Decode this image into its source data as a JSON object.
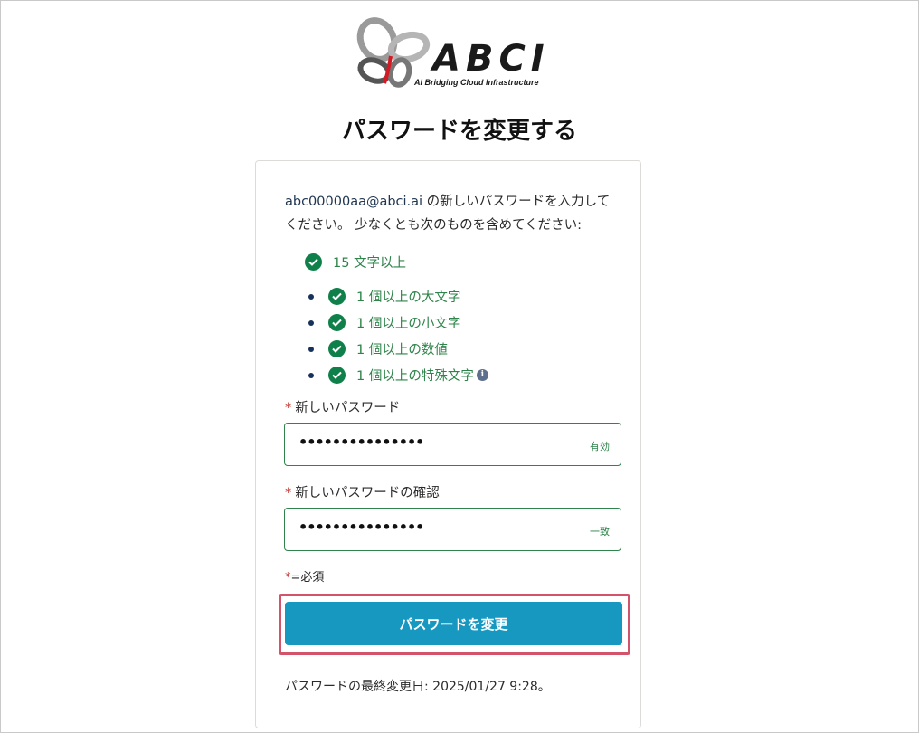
{
  "logo": {
    "text": "ABCI",
    "subtitle": "AI Bridging Cloud Infrastructure"
  },
  "page_title": "パスワードを変更する",
  "intro": {
    "email": "abc00000aa@abci.ai",
    "text_after_email": " の新しいパスワードを入力してください。 少なくとも次のものを含めてください:"
  },
  "requirements": {
    "min_length": "15 文字以上",
    "items": [
      "1 個以上の大文字",
      "1 個以上の小文字",
      "1 個以上の数値",
      "1 個以上の特殊文字"
    ]
  },
  "new_password": {
    "label": "新しいパスワード",
    "value": "•••••••••••••••",
    "status": "有効"
  },
  "confirm_password": {
    "label": "新しいパスワードの確認",
    "value": "•••••••••••••••",
    "status": "一致"
  },
  "required_marker": "*",
  "required_note": "=必須",
  "submit_label": "パスワードを変更",
  "last_changed": "パスワードの最終変更日: 2025/01/27 9:28。",
  "colors": {
    "accent": "#1798c1",
    "success": "#2e844a",
    "required": "#c23934",
    "highlight": "#d3546a"
  },
  "icons": [
    "abci-logo",
    "check-icon",
    "info-icon"
  ]
}
